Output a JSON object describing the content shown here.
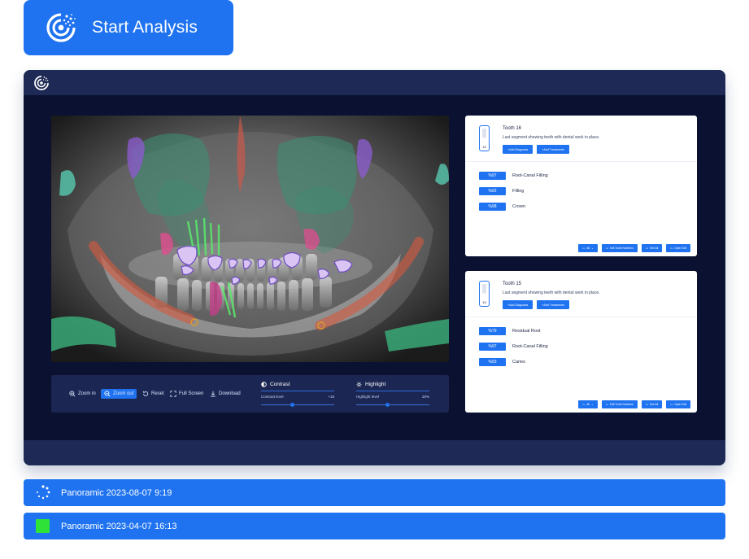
{
  "start_button": {
    "label": "Start Analysis"
  },
  "toolbar": {
    "zoom_in": "Zoom in",
    "zoom_out": "Zoom out",
    "reset": "Reset",
    "full_screen": "Full Screen",
    "download": "Download",
    "contrast": {
      "title": "Contrast",
      "label": "Contrast level",
      "value": "+18"
    },
    "highlight": {
      "title": "Highlight",
      "label": "Highlight level",
      "value": "20%"
    }
  },
  "cards": [
    {
      "title": "Tooth 16",
      "number": "16",
      "description": "Last segment showing teeth with dental work in place.",
      "add_diagnosis": "+Add Diagnosis",
      "add_treatments": "+Add Treatments",
      "findings": [
        {
          "pct": "%97",
          "label": "Root-Canal Filling"
        },
        {
          "pct": "%92",
          "label": "Filling"
        },
        {
          "pct": "%98",
          "label": "Crown"
        }
      ]
    },
    {
      "title": "Tooth 15",
      "number": "15",
      "description": "Last segment showing teeth with dental work in place.",
      "add_diagnosis": "+Add Diagnosis",
      "add_treatments": "+Add Treatments",
      "findings": [
        {
          "pct": "%79",
          "label": "Residual Root"
        },
        {
          "pct": "%97",
          "label": "Root-Canal Filling"
        },
        {
          "pct": "%93",
          "label": "Caries"
        }
      ]
    }
  ],
  "card_footer": {
    "all": "All",
    "edit_tooth_numbers": "Edit Tooth Numbers",
    "see_all": "See All",
    "open_edit": "Open Edit"
  },
  "scans": [
    {
      "label": "Panoramic 2023-08-07 9:19",
      "status": "loading"
    },
    {
      "label": "Panoramic 2023-04-07 16:13",
      "status": "complete",
      "status_color": "#2fe238"
    }
  ],
  "colors": {
    "accent": "#1f73f0",
    "panel": "#0b1131",
    "bar": "#1e2a55"
  }
}
